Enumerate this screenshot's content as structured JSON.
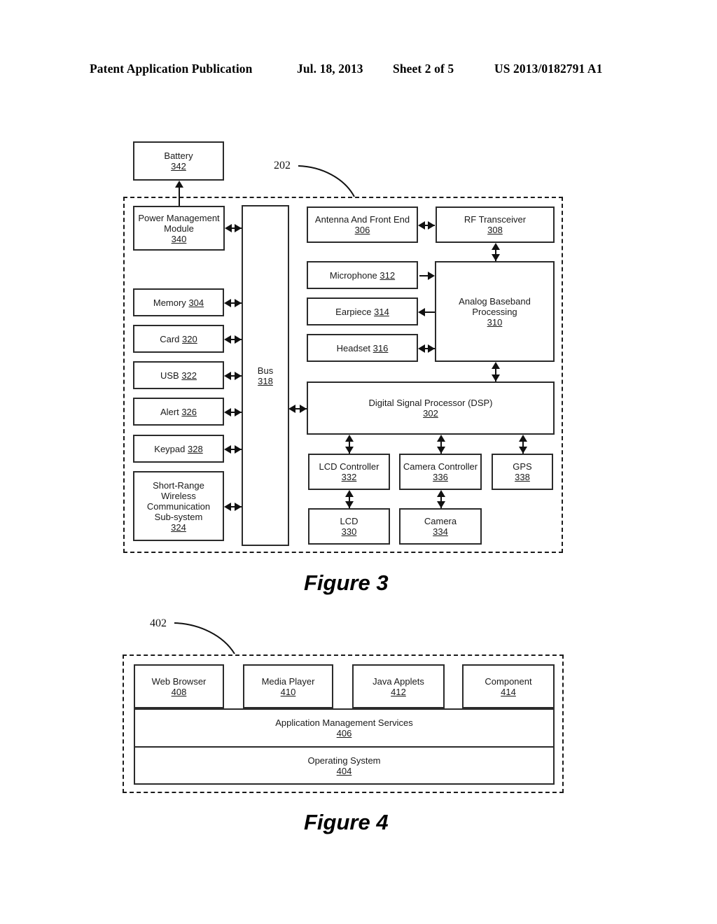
{
  "header": {
    "publication": "Patent Application Publication",
    "date": "Jul. 18, 2013",
    "sheet": "Sheet 2 of 5",
    "patent_number": "US 2013/0182791 A1"
  },
  "figure3": {
    "caption": "Figure 3",
    "enclosure_ref": "202",
    "blocks": {
      "battery": {
        "label": "Battery",
        "ref": "342"
      },
      "power_mgmt": {
        "label_line1": "Power Management",
        "label_line2": "Module",
        "ref": "340"
      },
      "memory": {
        "label": "Memory",
        "ref": "304"
      },
      "card": {
        "label": "Card",
        "ref": "320"
      },
      "usb": {
        "label": "USB",
        "ref": "322"
      },
      "alert": {
        "label": "Alert",
        "ref": "326"
      },
      "keypad": {
        "label": "Keypad",
        "ref": "328"
      },
      "short_range": {
        "label_line1": "Short-Range",
        "label_line2": "Wireless",
        "label_line3": "Communication",
        "label_line4": "Sub-system",
        "ref": "324"
      },
      "bus": {
        "label": "Bus",
        "ref": "318"
      },
      "antenna": {
        "label": "Antenna And Front End",
        "ref": "306"
      },
      "rf_transceiver": {
        "label": "RF Transceiver",
        "ref": "308"
      },
      "microphone": {
        "label": "Microphone",
        "ref": "312"
      },
      "earpiece": {
        "label": "Earpiece",
        "ref": "314"
      },
      "headset": {
        "label": "Headset",
        "ref": "316"
      },
      "analog_baseband": {
        "label_line1": "Analog Baseband",
        "label_line2": "Processing",
        "ref": "310"
      },
      "dsp": {
        "label": "Digital Signal Processor (DSP)",
        "ref": "302"
      },
      "lcd_controller": {
        "label": "LCD Controller",
        "ref": "332"
      },
      "camera_controller": {
        "label": "Camera Controller",
        "ref": "336"
      },
      "gps": {
        "label": "GPS",
        "ref": "338"
      },
      "lcd": {
        "label": "LCD",
        "ref": "330"
      },
      "camera": {
        "label": "Camera",
        "ref": "334"
      }
    }
  },
  "figure4": {
    "caption": "Figure 4",
    "enclosure_ref": "402",
    "blocks": {
      "web_browser": {
        "label": "Web Browser",
        "ref": "408"
      },
      "media_player": {
        "label": "Media Player",
        "ref": "410"
      },
      "java_applets": {
        "label": "Java Applets",
        "ref": "412"
      },
      "component": {
        "label": "Component",
        "ref": "414"
      },
      "app_mgmt": {
        "label": "Application Management Services",
        "ref": "406"
      },
      "os": {
        "label": "Operating System",
        "ref": "404"
      }
    }
  }
}
